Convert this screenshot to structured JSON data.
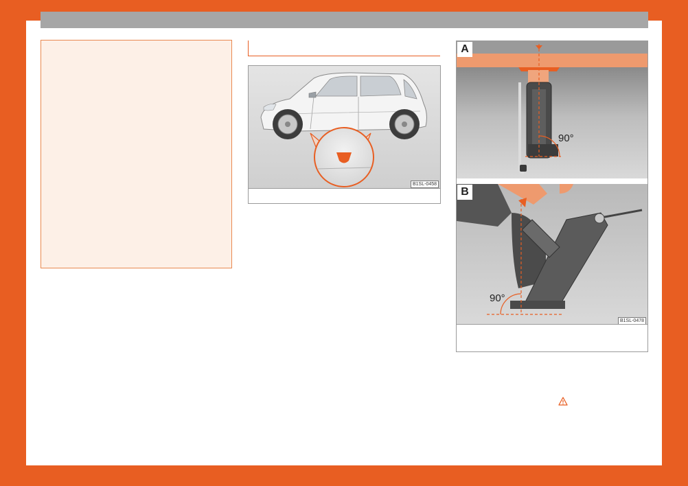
{
  "figure1": {
    "code": "B1SL-0458"
  },
  "figure2": {
    "panel_a_label": "A",
    "panel_b_label": "B",
    "angle_a": "90°",
    "angle_b": "90°",
    "code": "B1SL-0478"
  },
  "colors": {
    "accent": "#e85e22",
    "warning_box_bg": "#fdf0e7",
    "header_bar": "#a6a6a6"
  },
  "icons": {
    "warning": "warning-triangle-icon"
  }
}
